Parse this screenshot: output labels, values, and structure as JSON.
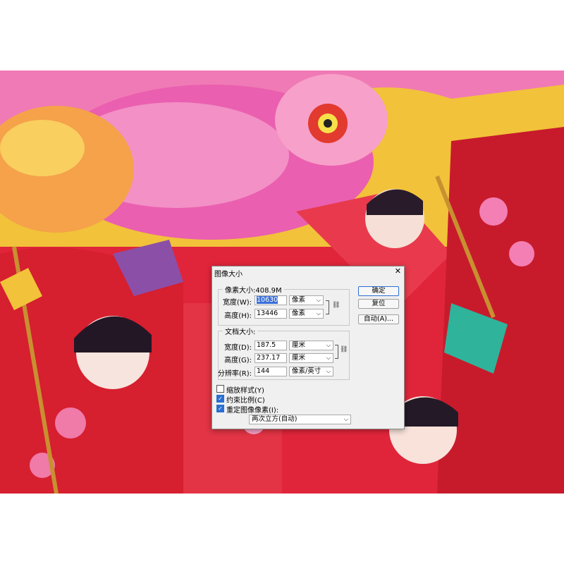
{
  "dialog": {
    "title": "图像大小",
    "close_icon": "close-icon",
    "pixel_dimensions": {
      "label": "像素大小:408.9M",
      "width_label": "宽度(W):",
      "width_value": "10630",
      "width_unit": "像素",
      "height_label": "高度(H):",
      "height_value": "13446",
      "height_unit": "像素"
    },
    "document_size": {
      "label": "文档大小:",
      "width_label": "宽度(D):",
      "width_value": "187.5",
      "width_unit": "厘米",
      "height_label": "高度(G):",
      "height_value": "237.17",
      "height_unit": "厘米",
      "resolution_label": "分辨率(R):",
      "resolution_value": "144",
      "resolution_unit": "像素/英寸"
    },
    "buttons": {
      "ok": "确定",
      "reset": "复位",
      "auto": "自动(A)..."
    },
    "options": {
      "scale_styles": {
        "label": "缩放样式(Y)",
        "checked": false
      },
      "constrain": {
        "label": "约束比例(C)",
        "checked": true
      },
      "resample": {
        "label": "重定图像像素(I):",
        "checked": true
      },
      "resample_method": "两次立方(自动)"
    }
  }
}
